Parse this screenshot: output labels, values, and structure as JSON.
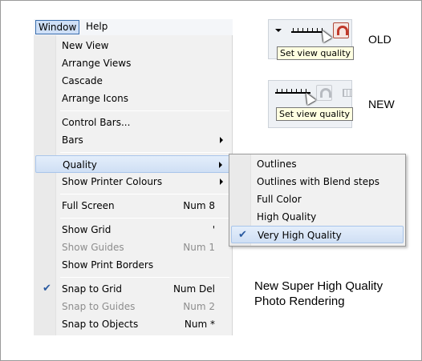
{
  "menubar": {
    "window": "Window",
    "help": "Help"
  },
  "window_menu": {
    "items": [
      {
        "label": "New View"
      },
      {
        "label": "Arrange Views"
      },
      {
        "label": "Cascade"
      },
      {
        "label": "Arrange Icons"
      },
      {
        "label": "Control Bars..."
      },
      {
        "label": "Bars"
      },
      {
        "label": "Quality"
      },
      {
        "label": "Show Printer Colours"
      },
      {
        "label": "Full Screen",
        "shortcut": "Num 8"
      },
      {
        "label": "Show Grid",
        "shortcut": "'"
      },
      {
        "label": "Show Guides",
        "shortcut": "Num 1"
      },
      {
        "label": "Show Print Borders"
      },
      {
        "label": "Snap to Grid",
        "shortcut": "Num Del"
      },
      {
        "label": "Snap to Guides",
        "shortcut": "Num 2"
      },
      {
        "label": "Snap to Objects",
        "shortcut": "Num *"
      }
    ]
  },
  "quality_submenu": {
    "items": [
      {
        "label": "Outlines"
      },
      {
        "label": "Outlines with Blend steps"
      },
      {
        "label": "Full Color"
      },
      {
        "label": "High Quality"
      },
      {
        "label": "Very High Quality"
      }
    ]
  },
  "comparison": {
    "old_label": "OLD",
    "new_label": "NEW",
    "tooltip": "Set view quality"
  },
  "caption": {
    "line1": "New Super High Quality",
    "line2": "Photo Rendering"
  },
  "icons": {
    "check": "✔",
    "submenu_arrow": "chevron-right-icon",
    "quality_slider": "quality-slider-icon",
    "magnet": "magnet-icon",
    "grid": "grid-icon",
    "cursor": "mouse-pointer-icon"
  }
}
